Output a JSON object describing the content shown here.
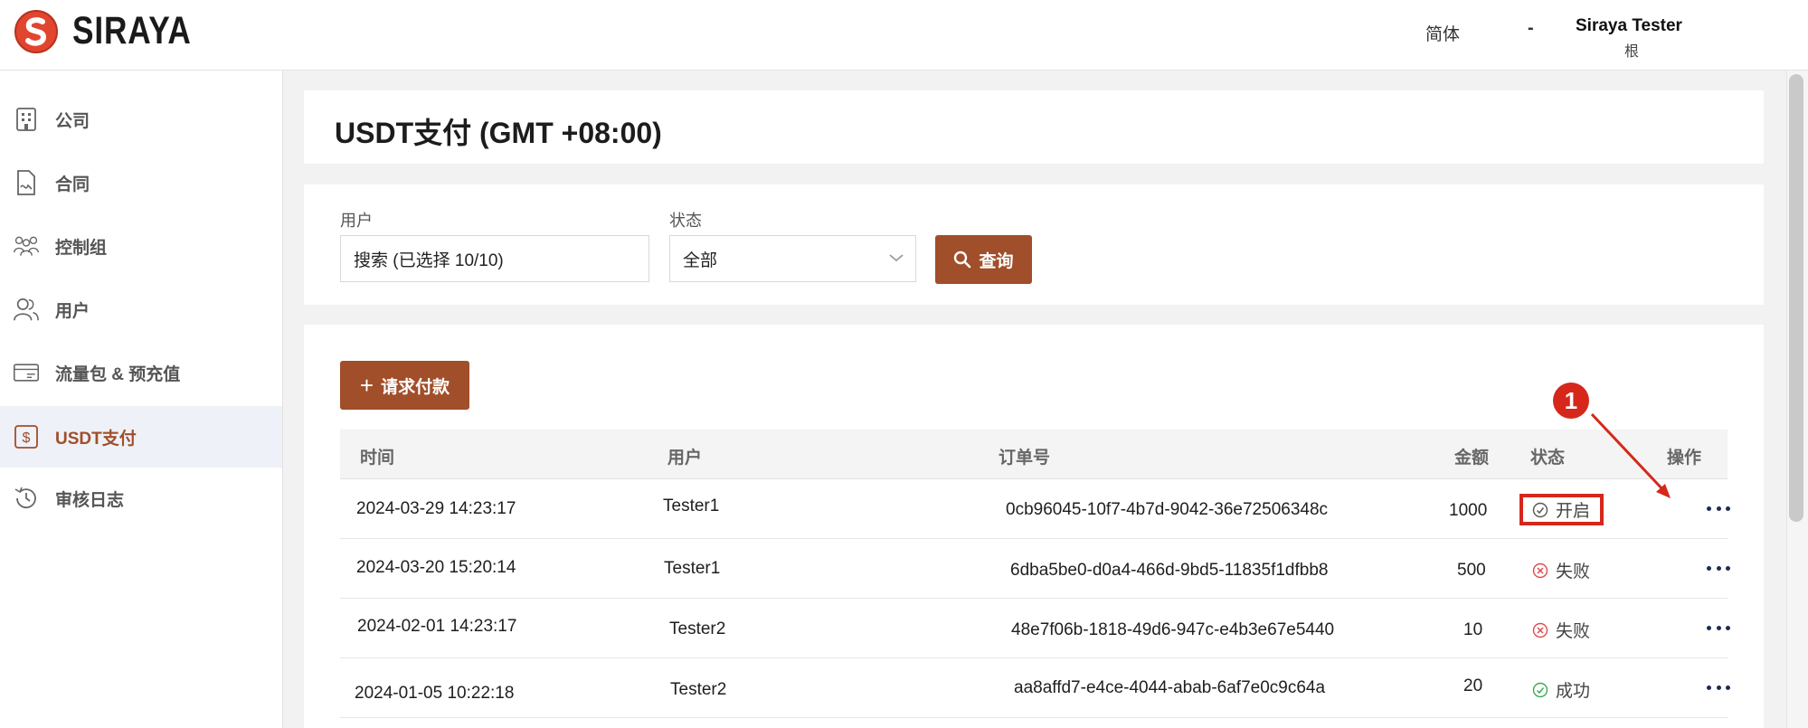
{
  "header": {
    "brand": "SIRAYA",
    "language": "简体",
    "separator": "-",
    "user_name": "Siraya Tester",
    "user_role": "根"
  },
  "sidebar": {
    "items": [
      {
        "label": "公司",
        "icon": "building-icon"
      },
      {
        "label": "合同",
        "icon": "contract-icon"
      },
      {
        "label": "控制组",
        "icon": "group-icon"
      },
      {
        "label": "用户",
        "icon": "users-icon"
      },
      {
        "label": "流量包 & 预充值",
        "icon": "card-icon"
      },
      {
        "label": "USDT支付",
        "icon": "dollar-icon",
        "active": true
      },
      {
        "label": "审核日志",
        "icon": "history-icon"
      }
    ]
  },
  "page": {
    "title": "USDT支付 (GMT +08:00)"
  },
  "filters": {
    "user_label": "用户",
    "user_value": "搜索 (已选择 10/10)",
    "status_label": "状态",
    "status_value": "全部",
    "query_label": "查询"
  },
  "table": {
    "add_label": "请求付款",
    "columns": [
      "时间",
      "用户",
      "订单号",
      "金额",
      "状态",
      "操作"
    ],
    "rows": [
      {
        "time": "2024-03-29 14:23:17",
        "user": "Tester1",
        "order": "0cb96045-10f7-4b7d-9042-36e72506348c",
        "amount": "1000",
        "status": "开启",
        "status_kind": "open"
      },
      {
        "time": "2024-03-20 15:20:14",
        "user": "Tester1",
        "order": "6dba5be0-d0a4-466d-9bd5-11835f1dfbb8",
        "amount": "500",
        "status": "失败",
        "status_kind": "fail"
      },
      {
        "time": "2024-02-01 14:23:17",
        "user": "Tester2",
        "order": "48e7f06b-1818-49d6-947c-e4b3e67e5440",
        "amount": "10",
        "status": "失败",
        "status_kind": "fail"
      },
      {
        "time": "2024-01-05 10:22:18",
        "user": "Tester2",
        "order": "aa8affd7-e4ce-4044-abab-6af7e0c9c64a",
        "amount": "20",
        "status": "成功",
        "status_kind": "success"
      }
    ]
  },
  "annotation": {
    "badge": "1"
  },
  "colors": {
    "accent": "#a14e2a",
    "annotation": "#d5281b",
    "fail": "#e04b4b",
    "success": "#3aaa55",
    "active_bg": "#eef1f7"
  }
}
